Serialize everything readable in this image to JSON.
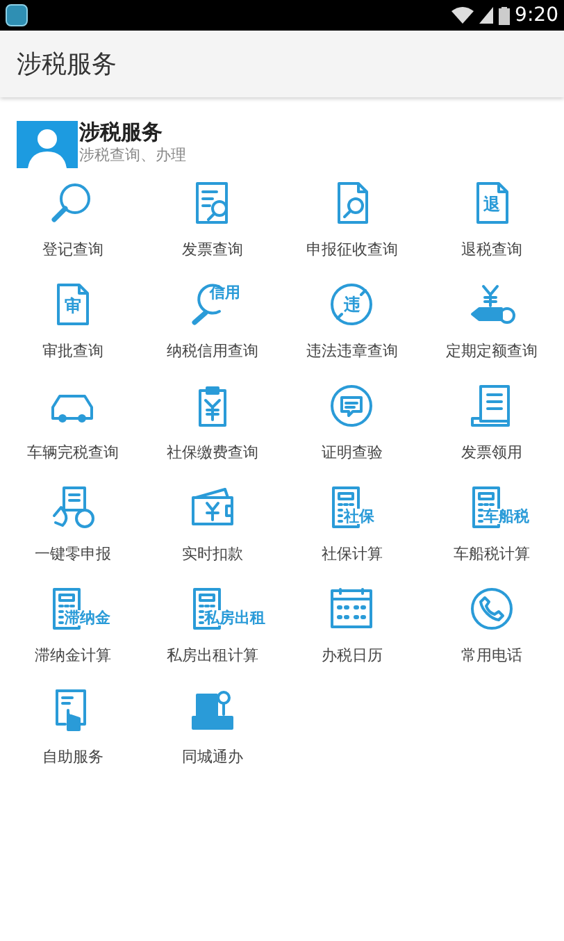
{
  "status_bar": {
    "time": "9:20"
  },
  "app_bar": {
    "title": "涉税服务"
  },
  "header": {
    "title": "涉税服务",
    "subtitle": "涉税查询、办理"
  },
  "items": [
    {
      "label": "登记查询",
      "kind": "search"
    },
    {
      "label": "发票查询",
      "kind": "list-search"
    },
    {
      "label": "申报征收查询",
      "kind": "doc-search"
    },
    {
      "label": "退税查询",
      "kind": "doc-text",
      "icon_text": "退"
    },
    {
      "label": "审批查询",
      "kind": "doc-text",
      "icon_text": "审"
    },
    {
      "label": "纳税信用查询",
      "kind": "lens-text",
      "icon_text": "信用"
    },
    {
      "label": "违法违章查询",
      "kind": "circle-slash",
      "icon_text": "违"
    },
    {
      "label": "定期定额查询",
      "kind": "hand-yen"
    },
    {
      "label": "车辆完税查询",
      "kind": "car"
    },
    {
      "label": "社保缴费查询",
      "kind": "clipboard-yen"
    },
    {
      "label": "证明查验",
      "kind": "chat-circle"
    },
    {
      "label": "发票领用",
      "kind": "receipt"
    },
    {
      "label": "一键零申报",
      "kind": "hand-doc"
    },
    {
      "label": "实时扣款",
      "kind": "wallet"
    },
    {
      "label": "社保计算",
      "kind": "calculator",
      "icon_text": "社保"
    },
    {
      "label": "车船税计算",
      "kind": "calculator",
      "icon_text": "车船税"
    },
    {
      "label": "滞纳金计算",
      "kind": "calculator",
      "icon_text": "滞纳金"
    },
    {
      "label": "私房出租计算",
      "kind": "calculator",
      "icon_text": "私房出租"
    },
    {
      "label": "办税日历",
      "kind": "calendar"
    },
    {
      "label": "常用电话",
      "kind": "phone"
    },
    {
      "label": "自助服务",
      "kind": "tablet-touch"
    },
    {
      "label": "同城通办",
      "kind": "building"
    }
  ]
}
